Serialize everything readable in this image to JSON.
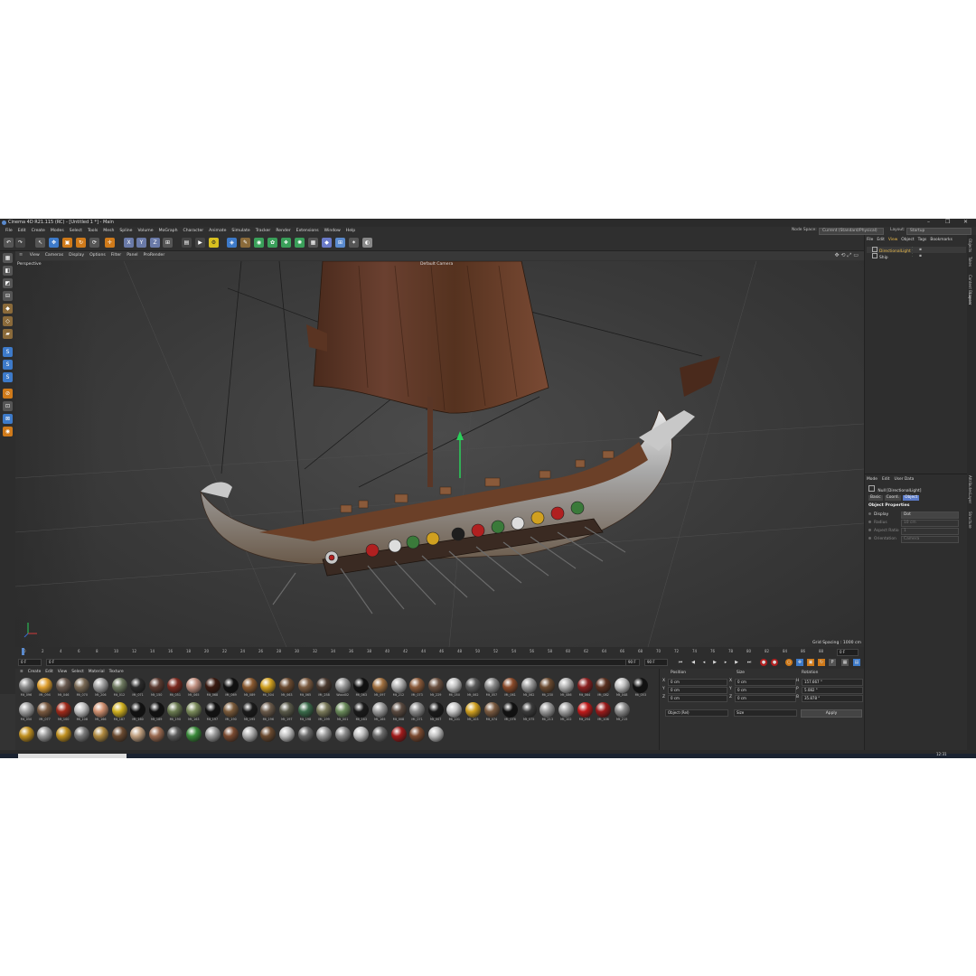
{
  "window": {
    "title": "Cinema 4D R21.115 (RC) - [Untitled 1 *] - Main",
    "controls": [
      "–",
      "❐",
      "✕"
    ]
  },
  "menu": [
    "File",
    "Edit",
    "Create",
    "Modes",
    "Select",
    "Tools",
    "Mesh",
    "Spline",
    "Volume",
    "MoGraph",
    "Character",
    "Animate",
    "Simulate",
    "Tracker",
    "Render",
    "Extensions",
    "Window",
    "Help"
  ],
  "node_space": {
    "label": "Node Space:",
    "value": "Current (Standard/Physical)"
  },
  "layout": {
    "label": "Layout:",
    "value": "Startup"
  },
  "viewport": {
    "menu": [
      "View",
      "Cameras",
      "Display",
      "Options",
      "Filter",
      "Panel",
      "ProRender"
    ],
    "name": "Perspective",
    "camera": "Default Camera",
    "grid_spacing": "Grid Spacing : 1000 cm"
  },
  "timeline": {
    "ticks": [
      "0",
      "2",
      "4",
      "6",
      "8",
      "10",
      "12",
      "14",
      "16",
      "18",
      "20",
      "22",
      "24",
      "26",
      "28",
      "30",
      "32",
      "34",
      "36",
      "38",
      "40",
      "42",
      "44",
      "46",
      "48",
      "50",
      "52",
      "54",
      "56",
      "58",
      "60",
      "62",
      "64",
      "66",
      "68",
      "70",
      "72",
      "74",
      "76",
      "78",
      "80",
      "82",
      "84",
      "86",
      "88",
      "90"
    ],
    "current_frame": "0 F",
    "start": "0 F",
    "preview_start": "0 F",
    "preview_end": "90 F",
    "end": "90 F"
  },
  "materials": {
    "menu": [
      "Create",
      "Edit",
      "View",
      "Select",
      "Material",
      "Texture"
    ],
    "row1": [
      {
        "name": "Mt_096",
        "color": "#8a8a8a"
      },
      {
        "name": "Mt_094",
        "color": "#e0a030"
      },
      {
        "name": "Mt_046",
        "color": "#6a5a50"
      },
      {
        "name": "Mt_070",
        "color": "#7a6a55"
      },
      {
        "name": "Mt_206",
        "color": "#a0a0a0"
      },
      {
        "name": "Mt_012",
        "color": "#6e7a60"
      },
      {
        "name": "Mt_071",
        "color": "#2a2a2a"
      },
      {
        "name": "Mt_150",
        "color": "#5a3a30"
      },
      {
        "name": "Mt_051",
        "color": "#7a2a20"
      },
      {
        "name": "Mt_065",
        "color": "#c09080"
      },
      {
        "name": "Mt_068",
        "color": "#3a1a10"
      },
      {
        "name": "Mt_069",
        "color": "#111111"
      },
      {
        "name": "Mt_089",
        "color": "#8a5a30"
      },
      {
        "name": "Mt_504",
        "color": "#d0a020"
      },
      {
        "name": "Mt_063",
        "color": "#6a4a30"
      },
      {
        "name": "Mt_065",
        "color": "#7a5a40"
      },
      {
        "name": "Mt_258",
        "color": "#4a3a30"
      },
      {
        "name": "Wood02",
        "color": "#9a9a9a"
      },
      {
        "name": "Mt_063",
        "color": "#111111"
      },
      {
        "name": "Mt_097",
        "color": "#a07040"
      },
      {
        "name": "Mt_212",
        "color": "#b0b0b0"
      },
      {
        "name": "Mt_073",
        "color": "#8a5a3a"
      },
      {
        "name": "Mt_229",
        "color": "#6a5040"
      },
      {
        "name": "Mt_050",
        "color": "#c0c0c0"
      },
      {
        "name": "Mt_062",
        "color": "#5a5a5a"
      },
      {
        "name": "Mt_057",
        "color": "#8a8a8a"
      },
      {
        "name": "Mt_061",
        "color": "#8a4a2a"
      },
      {
        "name": "Mt_062",
        "color": "#9a9a9a"
      },
      {
        "name": "Mt_230",
        "color": "#6a4a30"
      },
      {
        "name": "Mt_086",
        "color": "#b0b0b0"
      },
      {
        "name": "Mt_064",
        "color": "#8a2020"
      },
      {
        "name": "Mt_082",
        "color": "#5a3020"
      },
      {
        "name": "Mt_048",
        "color": "#c0c0c0"
      },
      {
        "name": "Mt_053",
        "color": "#111111"
      }
    ],
    "row2": [
      {
        "name": "Mt_050",
        "color": "#a0a0a0"
      },
      {
        "name": "Mt_077",
        "color": "#7a5a40"
      },
      {
        "name": "Mt_100",
        "color": "#a02a1a"
      },
      {
        "name": "Mt_108",
        "color": "#c0c0c0"
      },
      {
        "name": "Mt_166",
        "color": "#d09070"
      },
      {
        "name": "Mt_187",
        "color": "#d0b020"
      },
      {
        "name": "Mt_160",
        "color": "#111111"
      },
      {
        "name": "Mt_189",
        "color": "#111111"
      },
      {
        "name": "Mt_190",
        "color": "#6a7a50"
      },
      {
        "name": "Mt_163",
        "color": "#7a8a5a"
      },
      {
        "name": "Mt_197",
        "color": "#111111"
      },
      {
        "name": "Mt_190",
        "color": "#7a5a3a"
      },
      {
        "name": "Mt_195",
        "color": "#1a1a1a"
      },
      {
        "name": "Mt_196",
        "color": "#6a5a4a"
      },
      {
        "name": "Mt_197",
        "color": "#5a5a4a"
      },
      {
        "name": "Mt_198",
        "color": "#3a6a4a"
      },
      {
        "name": "Mt_199",
        "color": "#7a7a5a"
      },
      {
        "name": "Mt_001",
        "color": "#6a8a5a"
      },
      {
        "name": "Mt_163",
        "color": "#1a1a1a"
      },
      {
        "name": "Mt_165",
        "color": "#9a9a9a"
      },
      {
        "name": "Mt_008",
        "color": "#5a4a40"
      },
      {
        "name": "Mt_071",
        "color": "#8a8a8a"
      },
      {
        "name": "Mt_007",
        "color": "#1a1a1a"
      },
      {
        "name": "Mt_101",
        "color": "#c8c8c8"
      },
      {
        "name": "Mt_103",
        "color": "#d0a020"
      },
      {
        "name": "Mt_074",
        "color": "#7a5a40"
      },
      {
        "name": "Mt_076",
        "color": "#111111"
      },
      {
        "name": "Mt_075",
        "color": "#3a3a3a"
      },
      {
        "name": "Mt_213",
        "color": "#9a9a9a"
      },
      {
        "name": "Mt_102",
        "color": "#a0a0a0"
      },
      {
        "name": "Mt_254",
        "color": "#c01a1a"
      },
      {
        "name": "Mt_106",
        "color": "#9a1a1a"
      },
      {
        "name": "Mt_215",
        "color": "#8a8a8a"
      }
    ],
    "row3": [
      {
        "color": "#c09020"
      },
      {
        "color": "#9a9a9a"
      },
      {
        "color": "#c09020"
      },
      {
        "color": "#7a7a7a"
      },
      {
        "color": "#b08a40"
      },
      {
        "color": "#6a4a30"
      },
      {
        "color": "#c0a080"
      },
      {
        "color": "#9a6a50"
      },
      {
        "color": "#5a5a5a"
      },
      {
        "color": "#3a8a3a"
      },
      {
        "color": "#9a9a9a"
      },
      {
        "color": "#7a4a30"
      },
      {
        "color": "#b0b0b0"
      },
      {
        "color": "#6a4a30"
      },
      {
        "color": "#c0c0c0"
      },
      {
        "color": "#6a6a6a"
      },
      {
        "color": "#9a9a9a"
      },
      {
        "color": "#8a8a8a"
      },
      {
        "color": "#c0c0c0"
      },
      {
        "color": "#6a6a6a"
      },
      {
        "color": "#a01a1a"
      },
      {
        "color": "#7a4a30"
      },
      {
        "color": "#c0c0c0"
      }
    ]
  },
  "coords": {
    "headers": [
      "Position",
      "Size",
      "Rotation"
    ],
    "rows": [
      {
        "axis": "X",
        "pos": "0 cm",
        "sizeaxis": "X",
        "size": "0 cm",
        "rotaxis": "H",
        "rot": "157.667 °"
      },
      {
        "axis": "Y",
        "pos": "0 cm",
        "sizeaxis": "Y",
        "size": "0 cm",
        "rotaxis": "P",
        "rot": "5.082 °"
      },
      {
        "axis": "Z",
        "pos": "0 cm",
        "sizeaxis": "Z",
        "size": "0 cm",
        "rotaxis": "B",
        "rot": "35.878 °"
      }
    ],
    "mode_select": "Object (Rel)",
    "size_select": "Size",
    "apply": "Apply"
  },
  "objects": {
    "menu": [
      "File",
      "Edit",
      "View",
      "Object",
      "Tags",
      "Bookmarks"
    ],
    "items": [
      {
        "name": "DirectionalLight",
        "highlight": true
      },
      {
        "name": "Ship",
        "highlight": false
      }
    ]
  },
  "attributes": {
    "menu": [
      "Mode",
      "Edit",
      "User Data"
    ],
    "object_name": "Null [DirectionalLight]",
    "tabs": [
      "Basic",
      "Coord.",
      "Object"
    ],
    "section": "Object Properties",
    "props": [
      {
        "label": "Display",
        "value": "Dot"
      },
      {
        "label": "Radius",
        "value": "10 cm"
      },
      {
        "label": "Aspect Ratio",
        "value": "1"
      },
      {
        "label": "Orientation",
        "value": "Camera"
      }
    ]
  },
  "side_tabs_top": [
    "Objects",
    "Takes",
    "Content Browser",
    "Layers"
  ],
  "side_tabs_bottom": [
    "Attributes",
    "Layer",
    "Structure"
  ],
  "taskbar": {
    "time": "12:31"
  }
}
